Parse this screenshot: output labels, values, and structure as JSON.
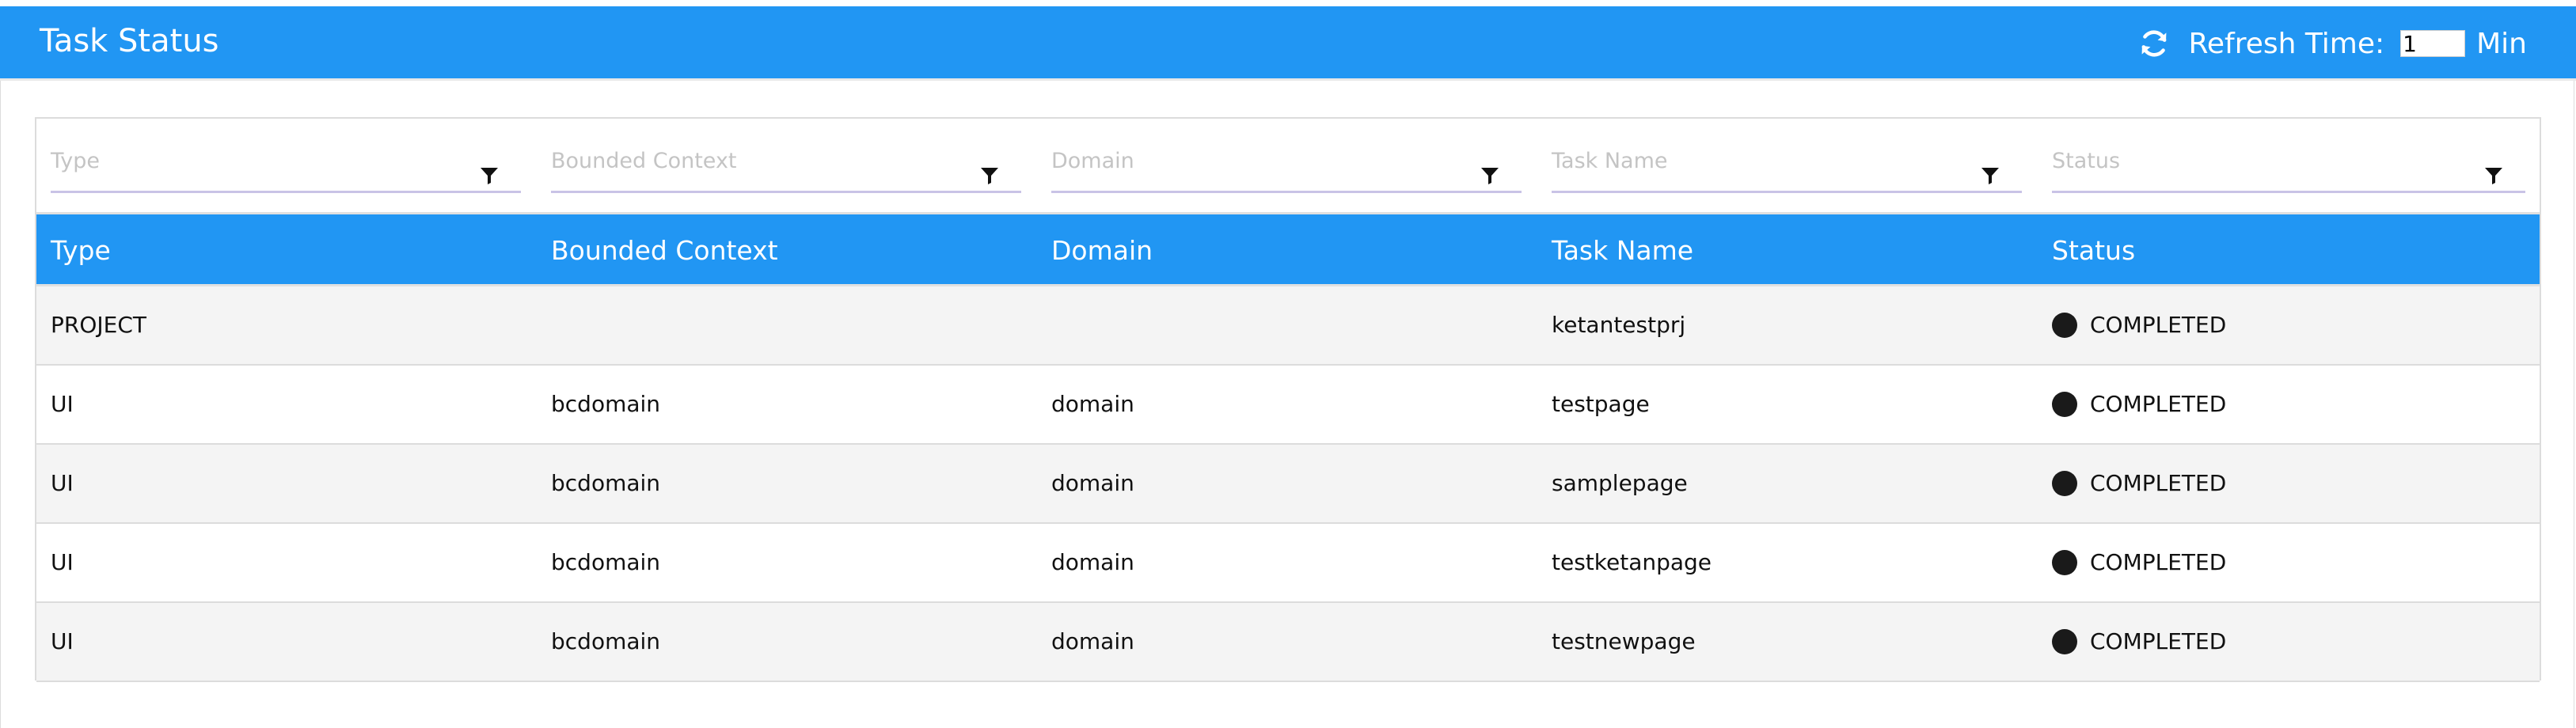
{
  "header": {
    "title": "Task Status",
    "refresh_label": "Refresh Time:",
    "refresh_value": "1",
    "refresh_unit": "Min",
    "refresh_icon": "refresh-icon"
  },
  "filters": [
    {
      "placeholder": "Type",
      "icon": "filter-icon"
    },
    {
      "placeholder": "Bounded Context",
      "icon": "filter-icon"
    },
    {
      "placeholder": "Domain",
      "icon": "filter-icon"
    },
    {
      "placeholder": "Task Name",
      "icon": "filter-icon"
    },
    {
      "placeholder": "Status",
      "icon": "filter-icon"
    }
  ],
  "table": {
    "columns": [
      "Type",
      "Bounded Context",
      "Domain",
      "Task Name",
      "Status"
    ],
    "rows": [
      {
        "type": "PROJECT",
        "bounded_context": "",
        "domain": "",
        "task_name": "ketantestprj",
        "status": "COMPLETED"
      },
      {
        "type": "UI",
        "bounded_context": "bcdomain",
        "domain": "domain",
        "task_name": "testpage",
        "status": "COMPLETED"
      },
      {
        "type": "UI",
        "bounded_context": "bcdomain",
        "domain": "domain",
        "task_name": "samplepage",
        "status": "COMPLETED"
      },
      {
        "type": "UI",
        "bounded_context": "bcdomain",
        "domain": "domain",
        "task_name": "testketanpage",
        "status": "COMPLETED"
      },
      {
        "type": "UI",
        "bounded_context": "bcdomain",
        "domain": "domain",
        "task_name": "testnewpage",
        "status": "COMPLETED"
      }
    ]
  },
  "colors": {
    "header_bg": "#2196f3",
    "status_dot": "#1a1a1a",
    "row_alt_bg": "#f4f4f4"
  }
}
